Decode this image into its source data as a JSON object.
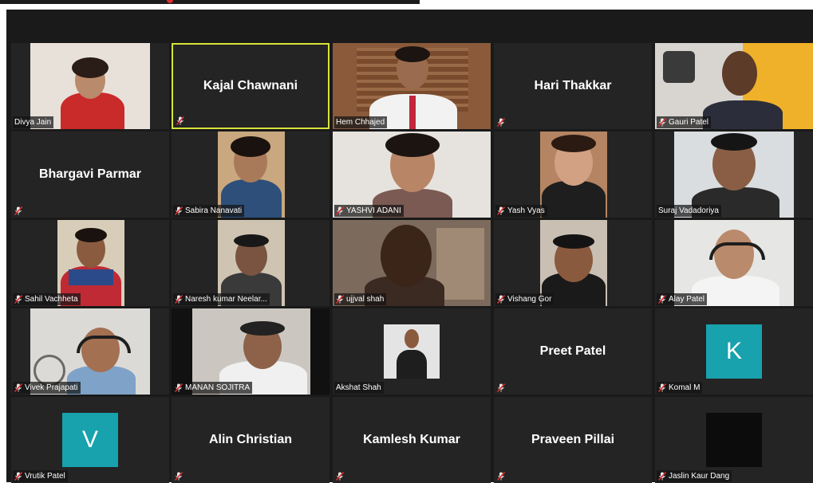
{
  "colors": {
    "window_bg": "#1a1a1a",
    "tile_bg": "#242424",
    "active_speaker_border": "#d6e33a",
    "muted_icon": "#e02b2b",
    "avatar_teal": "#17a2ad"
  },
  "icons": {
    "muted": "mic-muted-icon"
  },
  "participants": [
    {
      "name": "Divya Jain",
      "muted": false
    },
    {
      "name": "Kajal Chawnani",
      "muted": true,
      "active": true
    },
    {
      "name": "Hem Chhajed",
      "muted": false
    },
    {
      "name": "Hari Thakkar",
      "muted": true
    },
    {
      "name": "Gauri Patel",
      "muted": true
    },
    {
      "name": "Bhargavi Parmar",
      "muted": true
    },
    {
      "name": "Sabira Nanavati",
      "muted": true
    },
    {
      "name": "YASHVI ADANI",
      "muted": true
    },
    {
      "name": "Yash Vyas",
      "muted": true
    },
    {
      "name": "Suraj Vadadoriya",
      "muted": false
    },
    {
      "name": "Sahil Vachheta",
      "muted": true
    },
    {
      "name": "Naresh kumar Neelar...",
      "muted": true
    },
    {
      "name": "ujjval shah",
      "muted": true
    },
    {
      "name": "Vishang Gor",
      "muted": true
    },
    {
      "name": "Alay Patel",
      "muted": true
    },
    {
      "name": "Vivek Prajapati",
      "muted": true
    },
    {
      "name": "MANAN SOJITRA",
      "muted": true
    },
    {
      "name": "Akshat Shah",
      "muted": false
    },
    {
      "name": "Preet Patel",
      "muted": true
    },
    {
      "name": "Komal M",
      "muted": true,
      "avatar_letter": "K"
    },
    {
      "name": "Vrutik Patel",
      "muted": true,
      "avatar_letter": "V"
    },
    {
      "name": "Alin Christian",
      "muted": true
    },
    {
      "name": "Kamlesh Kumar",
      "muted": true
    },
    {
      "name": "Praveen Pillai",
      "muted": true
    },
    {
      "name": "Jaslin Kaur Dang",
      "muted": true
    }
  ]
}
